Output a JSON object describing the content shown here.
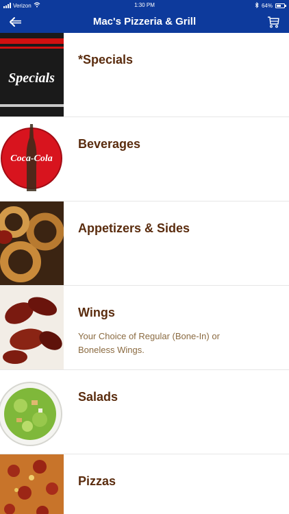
{
  "status_bar": {
    "carrier": "Verizon",
    "time": "1:30 PM",
    "battery": "64%",
    "battery_level": 0.64,
    "icons": [
      "signal-icon",
      "wifi-icon",
      "bluetooth-icon",
      "battery-icon"
    ]
  },
  "nav": {
    "title": "Mac's Pizzeria & Grill",
    "back_icon": "back-arrow-icon",
    "cart_icon": "cart-icon"
  },
  "colors": {
    "brand": "#0d3a9c",
    "item_title": "#5a2c0e",
    "item_desc": "#8a6a40"
  },
  "menu": {
    "items": [
      {
        "title": "*Specials",
        "description": "",
        "thumb_text": "Specials"
      },
      {
        "title": "Beverages",
        "description": "",
        "thumb_text": "Coca-Cola"
      },
      {
        "title": "Appetizers & Sides",
        "description": ""
      },
      {
        "title": "Wings",
        "description": "Your Choice of Regular (Bone-In) or Boneless Wings."
      },
      {
        "title": "Salads",
        "description": ""
      },
      {
        "title": "Pizzas",
        "description": ""
      }
    ]
  }
}
